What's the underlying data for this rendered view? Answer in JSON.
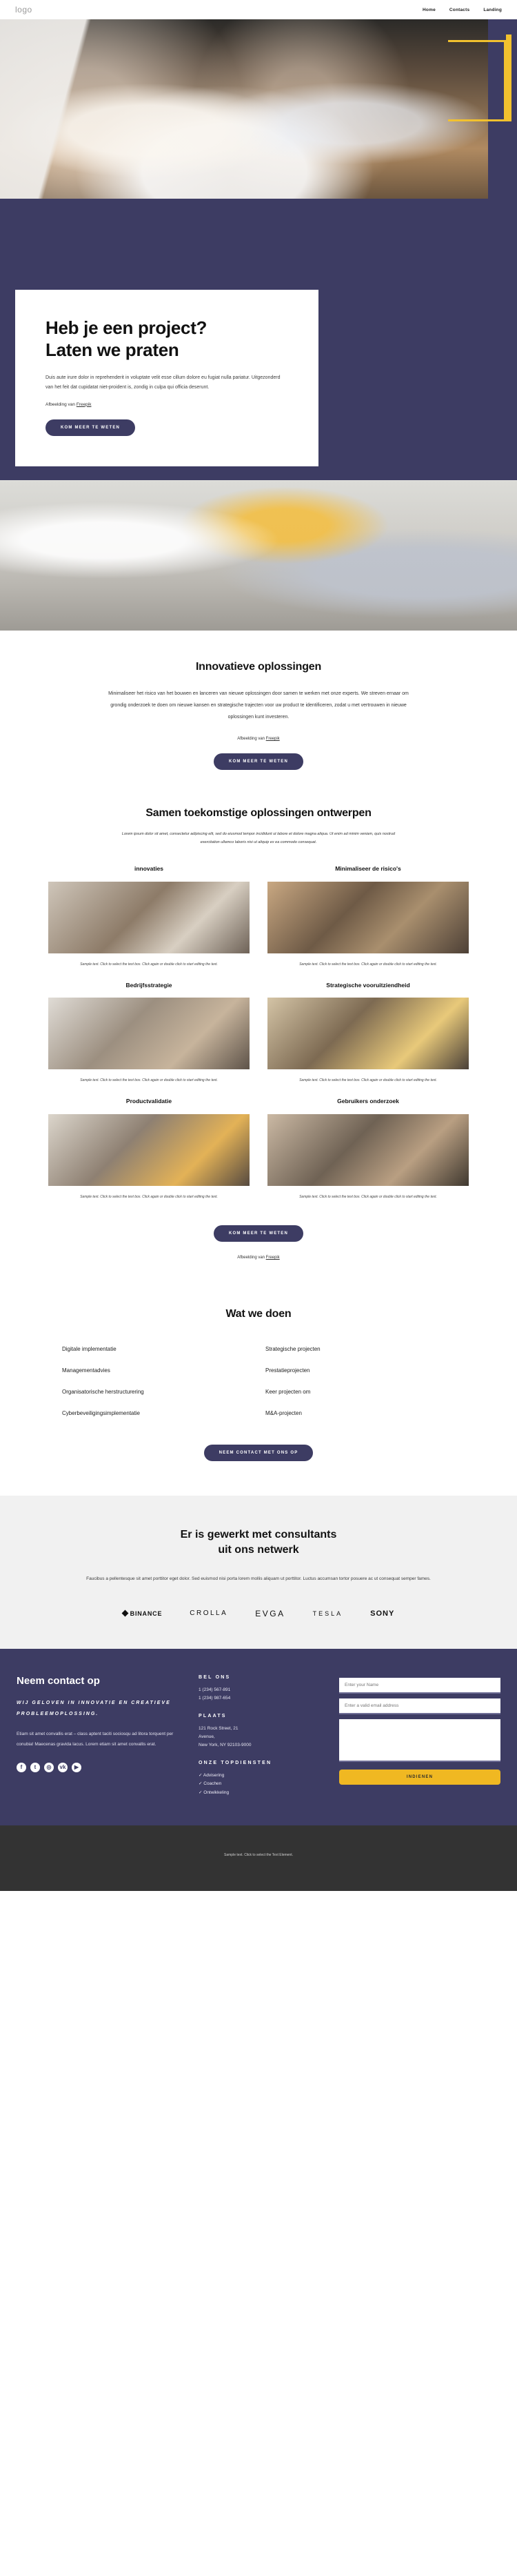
{
  "header": {
    "logo": "logo",
    "nav": [
      {
        "label": "Home"
      },
      {
        "label": "Contacts"
      },
      {
        "label": "Landing"
      }
    ]
  },
  "hero": {
    "title_line1": "Heb je een project?",
    "title_line2": "Laten we praten",
    "body": "Duis aute irure dolor in reprehenderit in voluptate velit esse cillum dolore eu fugiat nulla pariatur. Uitgezonderd van het feit dat cupidatat niet-proident is, zondig in culpa qui officia deserunt.",
    "credit_prefix": "Afbeelding van ",
    "credit_link": "Freepik",
    "cta": "KOM MEER TE WETEN"
  },
  "innovative": {
    "title": "Innovatieve oplossingen",
    "body": "Minimaliseer het risico van het bouwen en lanceren van nieuwe oplossingen door samen te werken met onze experts. We streven ernaar om grondig onderzoek te doen om nieuwe kansen en strategische trajecten voor uw product te identificeren, zodat u met vertrouwen in nieuwe oplossingen kunt investeren.",
    "credit_prefix": "Afbeelding van ",
    "credit_link": "Freepik",
    "cta": "KOM MEER TE WETEN"
  },
  "designing": {
    "title": "Samen toekomstige oplossingen ontwerpen",
    "intro": "Lorem ipsum dolor sit amet, consectetur adipiscing elit, sed do eiusmod tempor incididunt ut labore et dolore magna aliqua. Ut enim ad minim veniam, quis nostrud exercitation ullamco laboris nisi ut aliquip ex ea commodo consequat.",
    "caption": "Sample text. Click to select the text box. Click again or double click to start editing the text.",
    "cards": [
      {
        "title": "innovaties"
      },
      {
        "title": "Minimaliseer de risico's"
      },
      {
        "title": "Bedrijfsstrategie"
      },
      {
        "title": "Strategische vooruitziendheid"
      },
      {
        "title": "Productvalidatie"
      },
      {
        "title": "Gebruikers onderzoek"
      }
    ],
    "cta": "KOM MEER TE WETEN",
    "credit_prefix": "Afbeelding van ",
    "credit_link": "Freepik"
  },
  "what_we_do": {
    "title": "Wat we doen",
    "items": [
      "Digitale implementatie",
      "Strategische projecten",
      "Managementadvies",
      "Prestatieprojecten",
      "Organisatorische herstructurering",
      "Keer projecten om",
      "Cyberbeveiligingsimplementatie",
      "M&A-projecten"
    ],
    "cta": "NEEM CONTACT MET ONS OP"
  },
  "network": {
    "title_line1": "Er is gewerkt met consultants",
    "title_line2": "uit ons netwerk",
    "body": "Faucibus a pellentesque sit amet porttitor eget dolor. Sed euismod nisi porta lorem mollis aliquam ut porttitor. Luctus accumsan tortor posuere ac ut consequat semper fames.",
    "brands": [
      "BINANCE",
      "CROLLA",
      "EVGA",
      "TESLA",
      "SONY"
    ]
  },
  "footer": {
    "title": "Neem contact op",
    "slogan": "WIJ GELOVEN IN INNOVATIE EN CREATIEVE PROBLEEMOPLOSSING.",
    "body": "Etiam sit amet convallis erat – class aptent taciti sociosqu ad litora torquent per conubia! Maecenas gravida lacus. Lorem etiam sit amet convallis erat.",
    "socials": [
      "facebook-icon",
      "twitter-icon",
      "instagram-icon",
      "vk-icon",
      "youtube-icon"
    ],
    "call_heading": "BEL ONS",
    "phones": [
      "1 (234) 567-891",
      "1 (234) 987-654"
    ],
    "place_heading": "PLAATS",
    "address": [
      "121 Rock Street, 21",
      "Avenue,",
      "New York, NY 92103-9000"
    ],
    "services_heading": "ONZE TOPDIENSTEN",
    "services": [
      "Advisering",
      "Coachen",
      "Ontwikkeling"
    ],
    "form": {
      "name_placeholder": "Enter your Name",
      "email_placeholder": "Enter a valid email address",
      "message_placeholder": "",
      "submit": "INDIENEN"
    }
  },
  "bottom": {
    "text": "Sample text. Click to select the Text Element."
  },
  "colors": {
    "brand": "#3d3c63",
    "accent_yellow": "#f0b822",
    "light_gray": "#f1f1f1",
    "dark_bar": "#333333"
  }
}
